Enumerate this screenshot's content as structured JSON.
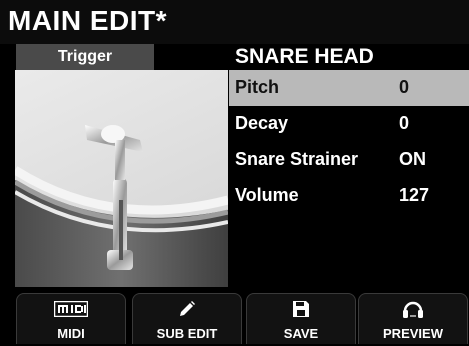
{
  "header": {
    "title": "MAIN EDIT*"
  },
  "tabs": {
    "trigger_label": "Trigger"
  },
  "section": {
    "title": "SNARE HEAD"
  },
  "params": [
    {
      "name": "Pitch",
      "value": "0",
      "selected": true
    },
    {
      "name": "Decay",
      "value": "0",
      "selected": false
    },
    {
      "name": "Snare Strainer",
      "value": "ON",
      "selected": false
    },
    {
      "name": "Volume",
      "value": "127",
      "selected": false
    }
  ],
  "softkeys": [
    {
      "label": "MIDI",
      "icon": "midi-icon"
    },
    {
      "label": "SUB EDIT",
      "icon": "pencil-icon"
    },
    {
      "label": "SAVE",
      "icon": "floppy-disk-icon"
    },
    {
      "label": "PREVIEW",
      "icon": "headphones-icon"
    }
  ],
  "colors": {
    "selected_row": "#b9b9b9",
    "tab_bg": "#4a4a4a",
    "background": "#000000"
  }
}
